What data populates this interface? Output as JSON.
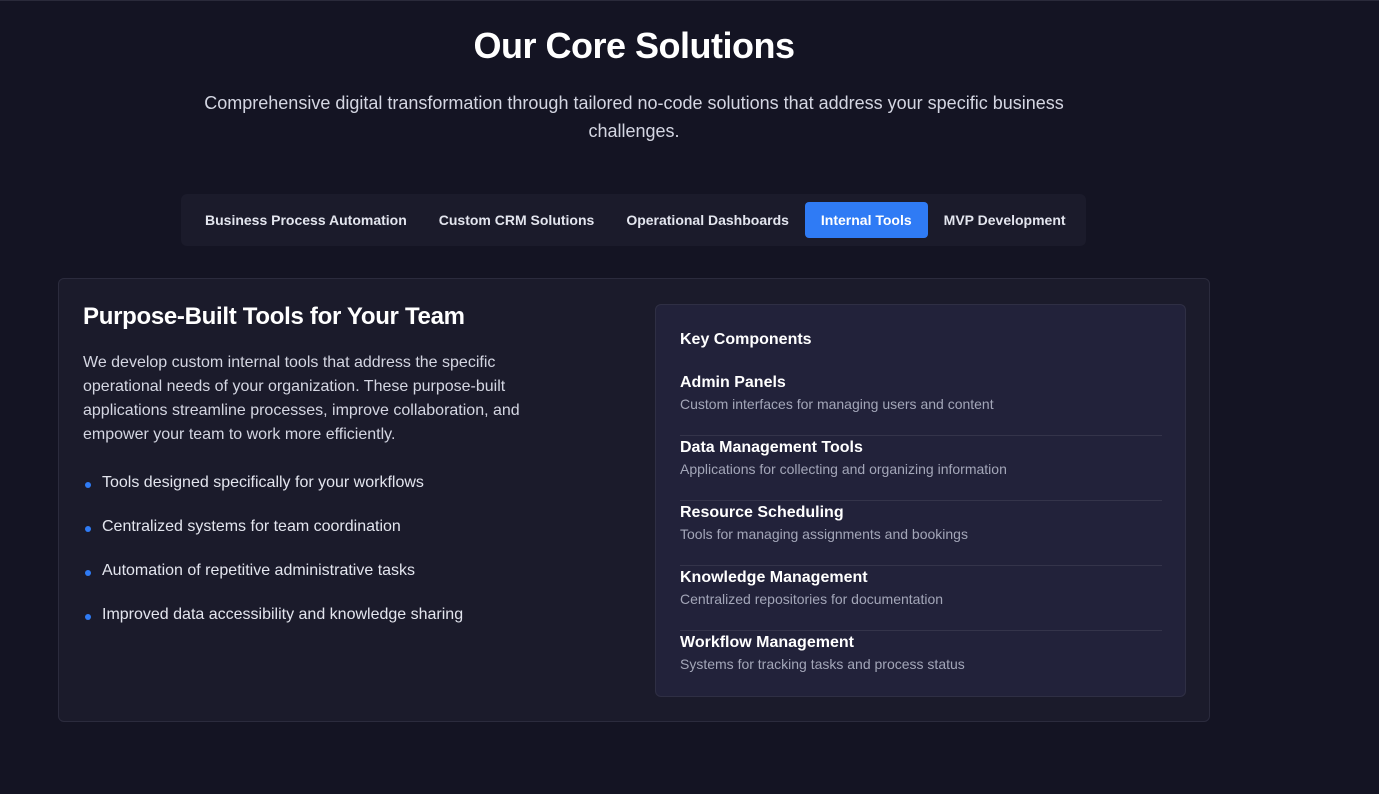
{
  "header": {
    "title": "Our Core Solutions",
    "subtitle": "Comprehensive digital transformation through tailored no-code solutions that address your specific business challenges."
  },
  "tabs": [
    {
      "label": "Business Process Automation",
      "active": false
    },
    {
      "label": "Custom CRM Solutions",
      "active": false
    },
    {
      "label": "Operational Dashboards",
      "active": false
    },
    {
      "label": "Internal Tools",
      "active": true
    },
    {
      "label": "MVP Development",
      "active": false
    }
  ],
  "content": {
    "title": "Purpose-Built Tools for Your Team",
    "description": "We develop custom internal tools that address the specific operational needs of your organization. These purpose-built applications streamline processes, improve collaboration, and empower your team to work more efficiently.",
    "features": [
      "Tools designed specifically for your workflows",
      "Centralized systems for team coordination",
      "Automation of repetitive administrative tasks",
      "Improved data accessibility and knowledge sharing"
    ],
    "components_title": "Key Components",
    "components": [
      {
        "name": "Admin Panels",
        "description": "Custom interfaces for managing users and content"
      },
      {
        "name": "Data Management Tools",
        "description": "Applications for collecting and organizing information"
      },
      {
        "name": "Resource Scheduling",
        "description": "Tools for managing assignments and bookings"
      },
      {
        "name": "Knowledge Management",
        "description": "Centralized repositories for documentation"
      },
      {
        "name": "Workflow Management",
        "description": "Systems for tracking tasks and process status"
      }
    ]
  },
  "colors": {
    "background": "#141423",
    "card": "#1b1b2b",
    "panel": "#22223a",
    "accent": "#2f7bf5"
  }
}
